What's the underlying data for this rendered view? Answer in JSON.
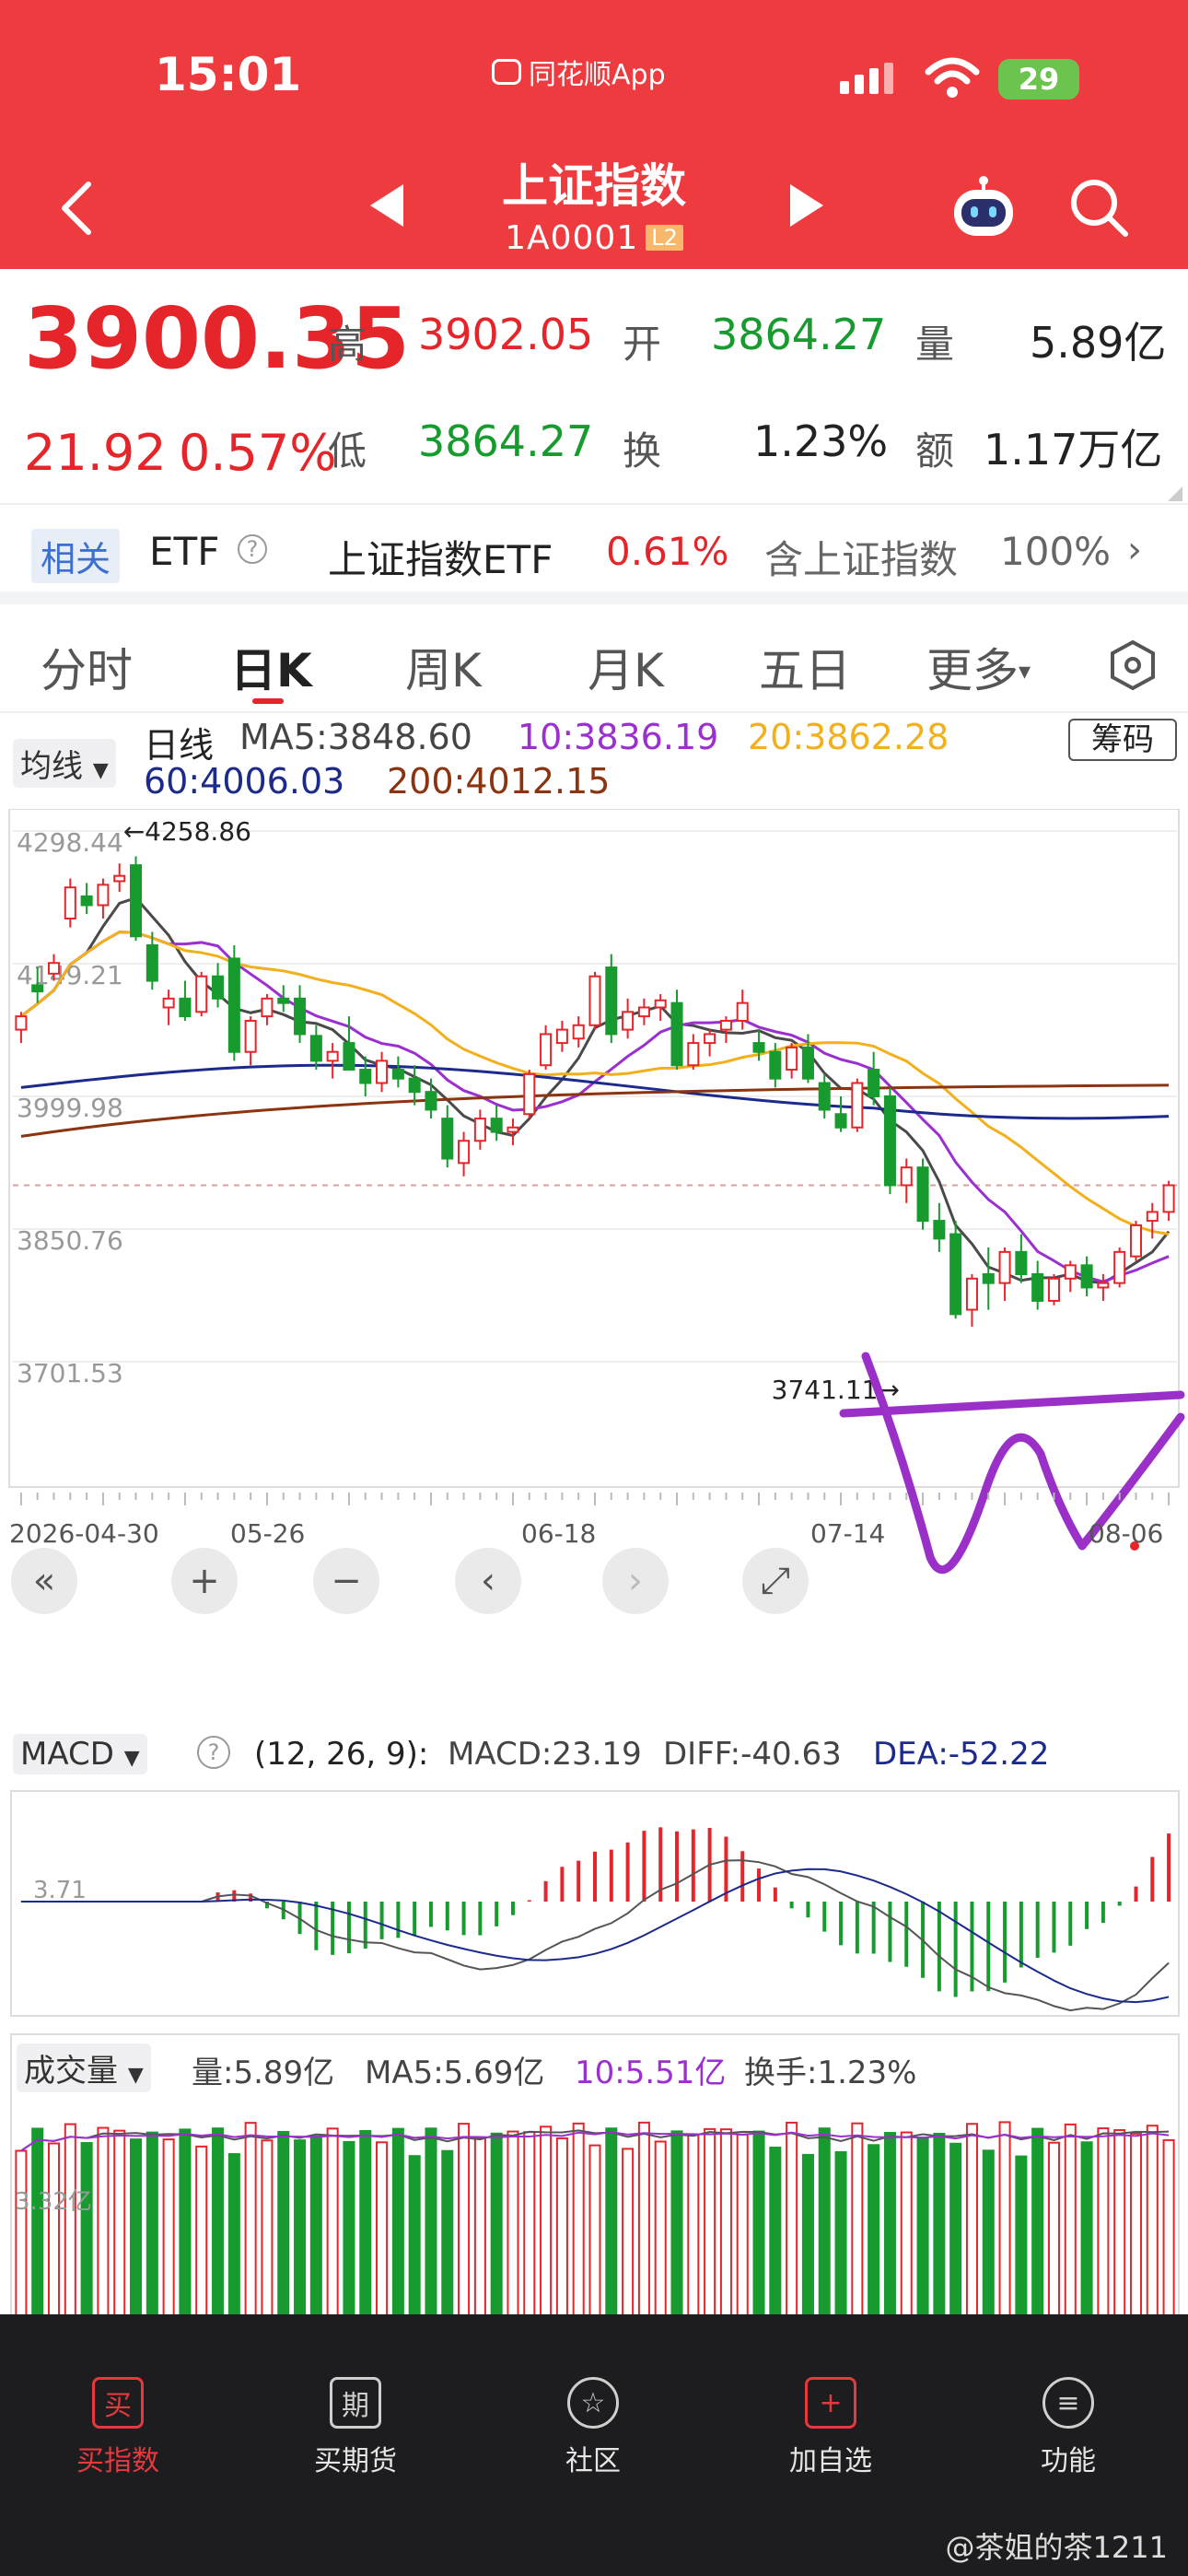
{
  "status_bar": {
    "time": "15:01",
    "app_name": "同花顺App",
    "battery": "29"
  },
  "header": {
    "title": "上证指数",
    "code": "1A0001",
    "level": "L2"
  },
  "quote": {
    "price": "3900.35",
    "change": "21.92",
    "change_pct": "0.57%",
    "high_label": "高",
    "high": "3902.05",
    "low_label": "低",
    "low": "3864.27",
    "open_label": "开",
    "open": "3864.27",
    "turnover_label": "换",
    "turnover": "1.23%",
    "volume_label": "量",
    "volume": "5.89亿",
    "amount_label": "额",
    "amount": "1.17万亿"
  },
  "etf": {
    "tag": "相关",
    "label": "ETF",
    "name": "上证指数ETF",
    "pct": "0.61%",
    "contain": "含上证指数",
    "contain_pct": "100%"
  },
  "tabs": [
    "分时",
    "日K",
    "周K",
    "月K",
    "五日",
    "更多"
  ],
  "ma_legend": {
    "indicator": "均线",
    "period": "日线",
    "ma5": "MA5:3848.60",
    "ma10": "10:3836.19",
    "ma20": "20:3862.28",
    "ma60": "60:4006.03",
    "ma200": "200:4012.15",
    "chip_button": "筹码"
  },
  "colors": {
    "up": "#e5252a",
    "down": "#179b2e",
    "ma5": "#4a4a4a",
    "ma10": "#9b2fcf",
    "ma20": "#f2b01c",
    "ma60": "#1c2a8c",
    "ma200": "#8a3410",
    "annotation": "#9b30c8"
  },
  "chart_data": {
    "type": "candlestick",
    "y_axis_labels": [
      "4298.44",
      "4149.21",
      "3999.98",
      "3850.76",
      "3701.53"
    ],
    "ylim": [
      3701.53,
      4298.44
    ],
    "x_labels": [
      "2026-04-30",
      "05-26",
      "06-18",
      "07-14",
      "08-06"
    ],
    "max_annotation": "←4258.86",
    "min_annotation": "3741.11→",
    "candles": [
      [
        4075,
        4095,
        4060,
        4090
      ],
      [
        4125,
        4145,
        4105,
        4118
      ],
      [
        4138,
        4160,
        4130,
        4150
      ],
      [
        4200,
        4245,
        4190,
        4235
      ],
      [
        4225,
        4240,
        4205,
        4215
      ],
      [
        4215,
        4245,
        4200,
        4238
      ],
      [
        4242,
        4262,
        4230,
        4248
      ],
      [
        4260,
        4270,
        4175,
        4180
      ],
      [
        4170,
        4185,
        4120,
        4130
      ],
      [
        4100,
        4120,
        4080,
        4110
      ],
      [
        4110,
        4130,
        4085,
        4090
      ],
      [
        4095,
        4140,
        4090,
        4135
      ],
      [
        4135,
        4150,
        4100,
        4110
      ],
      [
        4155,
        4170,
        4040,
        4050
      ],
      [
        4050,
        4090,
        4035,
        4085
      ],
      [
        4090,
        4115,
        4080,
        4110
      ],
      [
        4110,
        4125,
        4095,
        4105
      ],
      [
        4110,
        4125,
        4060,
        4070
      ],
      [
        4068,
        4080,
        4030,
        4040
      ],
      [
        4040,
        4060,
        4020,
        4050
      ],
      [
        4060,
        4090,
        4045,
        4030
      ],
      [
        4030,
        4045,
        4000,
        4015
      ],
      [
        4015,
        4050,
        4005,
        4040
      ],
      [
        4030,
        4045,
        4010,
        4020
      ],
      [
        4020,
        4035,
        3990,
        4005
      ],
      [
        4005,
        4020,
        3975,
        3985
      ],
      [
        3975,
        3990,
        3920,
        3930
      ],
      [
        3925,
        3960,
        3910,
        3950
      ],
      [
        3950,
        3985,
        3940,
        3975
      ],
      [
        3975,
        3990,
        3950,
        3960
      ],
      [
        3960,
        3975,
        3945,
        3965
      ],
      [
        3980,
        4030,
        3975,
        4025
      ],
      [
        4035,
        4080,
        4030,
        4070
      ],
      [
        4060,
        4085,
        4050,
        4075
      ],
      [
        4065,
        4090,
        4055,
        4080
      ],
      [
        4080,
        4140,
        4075,
        4135
      ],
      [
        4145,
        4160,
        4060,
        4070
      ],
      [
        4075,
        4110,
        4065,
        4095
      ],
      [
        4090,
        4110,
        4080,
        4100
      ],
      [
        4100,
        4115,
        4085,
        4108
      ],
      [
        4105,
        4120,
        4030,
        4035
      ],
      [
        4035,
        4070,
        4030,
        4060
      ],
      [
        4060,
        4075,
        4045,
        4070
      ],
      [
        4075,
        4090,
        4060,
        4085
      ],
      [
        4085,
        4120,
        4075,
        4105
      ],
      [
        4060,
        4075,
        4040,
        4050
      ],
      [
        4050,
        4060,
        4010,
        4020
      ],
      [
        4030,
        4060,
        4020,
        4055
      ],
      [
        4055,
        4070,
        4015,
        4020
      ],
      [
        4015,
        4025,
        3975,
        3985
      ],
      [
        3980,
        4000,
        3960,
        3965
      ],
      [
        3965,
        4020,
        3960,
        4015
      ],
      [
        4030,
        4050,
        3990,
        4000
      ],
      [
        4000,
        4010,
        3890,
        3900
      ],
      [
        3900,
        3930,
        3880,
        3920
      ],
      [
        3920,
        3930,
        3850,
        3860
      ],
      [
        3860,
        3880,
        3825,
        3840
      ],
      [
        3845,
        3860,
        3750,
        3755
      ],
      [
        3760,
        3800,
        3741,
        3795
      ],
      [
        3800,
        3830,
        3760,
        3790
      ],
      [
        3790,
        3830,
        3770,
        3825
      ],
      [
        3825,
        3845,
        3790,
        3800
      ],
      [
        3800,
        3815,
        3760,
        3770
      ],
      [
        3770,
        3800,
        3765,
        3795
      ],
      [
        3795,
        3815,
        3780,
        3810
      ],
      [
        3810,
        3820,
        3775,
        3785
      ],
      [
        3785,
        3800,
        3770,
        3790
      ],
      [
        3790,
        3830,
        3785,
        3825
      ],
      [
        3820,
        3860,
        3815,
        3855
      ],
      [
        3860,
        3880,
        3840,
        3870
      ],
      [
        3870,
        3905,
        3860,
        3900
      ]
    ]
  },
  "chart_buttons": [
    "«",
    "+",
    "−",
    "‹",
    "›",
    "⤢"
  ],
  "macd": {
    "indicator": "MACD",
    "params": "(12, 26, 9):",
    "macd": "MACD:23.19",
    "diff": "DIFF:-40.63",
    "dea": "DEA:-52.22",
    "axis_label": "3.71"
  },
  "volume": {
    "indicator": "成交量",
    "vol": "量:5.89亿",
    "ma5": "MA5:5.69亿",
    "ma10": "10:5.51亿",
    "turnover": "换手:1.23%",
    "axis_label": "3.32亿"
  },
  "nav": [
    {
      "label": "买指数",
      "icon": "买"
    },
    {
      "label": "买期货",
      "icon": "期"
    },
    {
      "label": "社区",
      "icon": "☆"
    },
    {
      "label": "加自选",
      "icon": "+"
    },
    {
      "label": "功能",
      "icon": "≡"
    }
  ],
  "watermark": "@茶姐的茶1211"
}
